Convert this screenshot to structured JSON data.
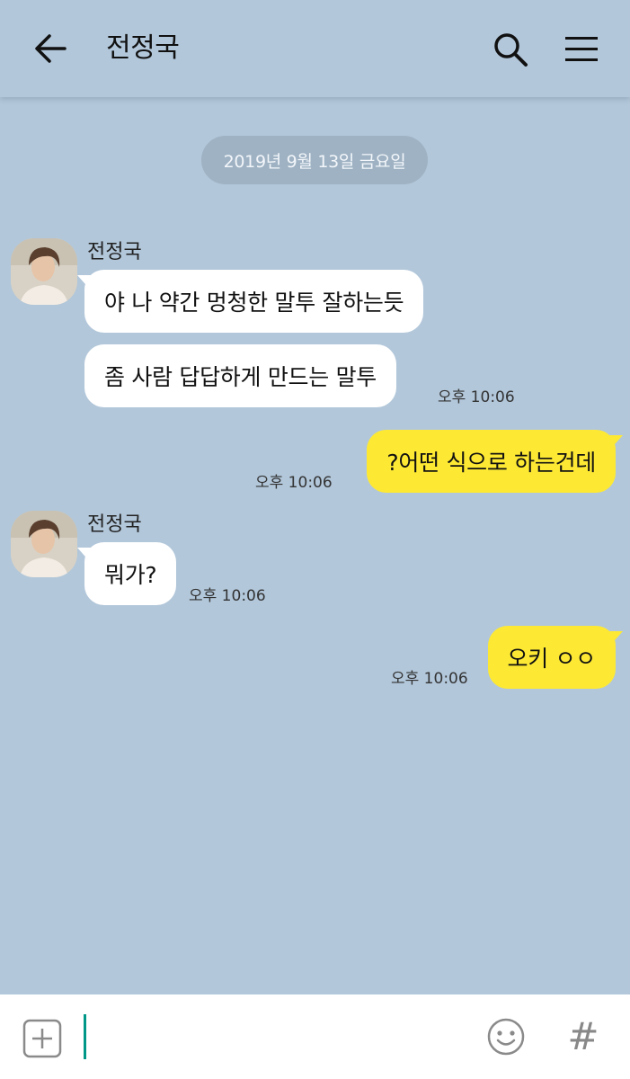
{
  "header": {
    "title": "전정국",
    "icons": {
      "back": "arrow-left-icon",
      "search": "search-icon",
      "menu": "hamburger-menu-icon"
    }
  },
  "date_divider": "2019년 9월 13일 금요일",
  "messages": [
    {
      "direction": "incoming",
      "sender": "전정국",
      "bubbles": [
        "야 나 약간 멍청한 말투 잘하는듯",
        "좀 사람 답답하게 만드는 말투"
      ],
      "time": "오후 10:06"
    },
    {
      "direction": "outgoing",
      "bubbles": [
        "?어떤 식으로 하는건데"
      ],
      "time": "오후 10:06"
    },
    {
      "direction": "incoming",
      "sender": "전정국",
      "bubbles": [
        "뭐가?"
      ],
      "time": "오후 10:06"
    },
    {
      "direction": "outgoing",
      "bubbles": [
        "오키 ㅇㅇ"
      ],
      "time": "오후 10:06"
    }
  ],
  "input_bar": {
    "value": "",
    "hash_label": "#",
    "icons": {
      "attach": "plus-square-icon",
      "emoji": "emoji-smile-icon"
    }
  },
  "colors": {
    "chat_background": "#b2c7da",
    "incoming_bubble": "#ffffff",
    "outgoing_bubble": "#fde934",
    "date_pill": "#9fb2c3",
    "caret": "#009688"
  }
}
